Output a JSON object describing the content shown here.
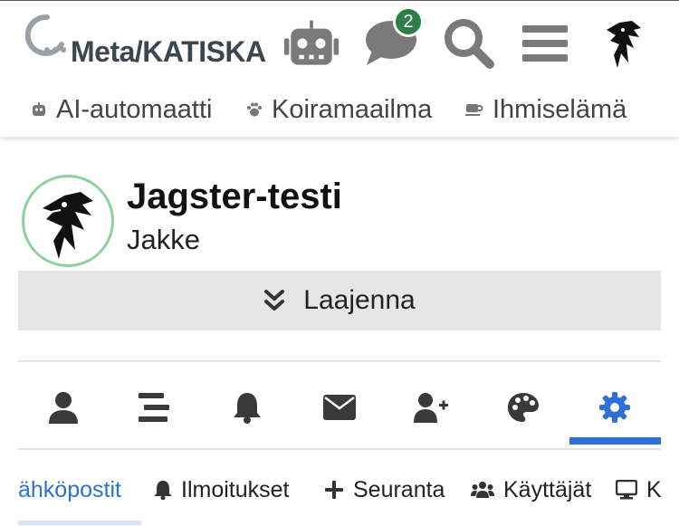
{
  "header": {
    "logo_text": "Meta/KATISKA",
    "notification_count": "2",
    "icons": [
      "robot-icon",
      "chat-icon",
      "search-icon",
      "menu-icon",
      "user-avatar"
    ]
  },
  "categories": [
    {
      "label": "AI-automaatti",
      "icon": "robot-icon"
    },
    {
      "label": "Koiramaailma",
      "icon": "paw-icon"
    },
    {
      "label": "Ihmiselämä",
      "icon": "coffee-icon"
    }
  ],
  "profile": {
    "name": "Jagster-testi",
    "username": "Jakke",
    "expand_label": "Laajenna"
  },
  "profile_tabs": [
    "user-icon",
    "posts-icon",
    "bell-icon",
    "envelope-icon",
    "user-plus-icon",
    "palette-icon",
    "gear-icon"
  ],
  "sub_tabs": [
    {
      "label": "ähköpostit",
      "icon": null,
      "active": true
    },
    {
      "label": "Ilmoitukset",
      "icon": "bell-icon"
    },
    {
      "label": "Seuranta",
      "icon": "plus-icon"
    },
    {
      "label": "Käyttäjät",
      "icon": "users-icon"
    },
    {
      "label": "K",
      "icon": "desktop-icon"
    }
  ],
  "colors": {
    "accent": "#2f6fd6",
    "badge": "#2e7d4a",
    "icon_gray": "#7a7a7a",
    "dark_icon": "#3a3a3a",
    "avatar_ring": "#8fd19e"
  }
}
